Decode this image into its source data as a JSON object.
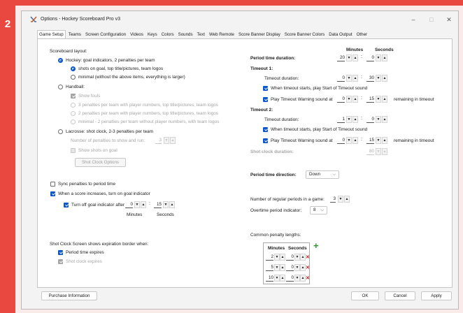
{
  "badge": "2",
  "window": {
    "title": "Options - Hockey Scoreboard Pro v3",
    "icon": "crossed-hockey-sticks-icon",
    "controls": {
      "minimize": "–",
      "maximize": "□",
      "close": "✕"
    }
  },
  "tabs": [
    "Game Setup",
    "Teams",
    "Screen Configuration",
    "Videos",
    "Keys",
    "Colors",
    "Sounds",
    "Text",
    "Web Remote",
    "Score Banner Display",
    "Score Banner Colors",
    "Data Output",
    "Other"
  ],
  "active_tab": "Game Setup",
  "left": {
    "layout_label": "Scoreboard layout:",
    "hockey": "Hockey: goal indicators, 2 penalties per team",
    "hockey_sub1": "shots on goal, top title/pictures, team logos",
    "hockey_sub2": "minimal (without the above items, everything is larger)",
    "handball": "Handball:",
    "show_fouls": "Show fouls",
    "hb_opt1": "3 penalties per team with player numbers, top title/pictures, team logos",
    "hb_opt2": "2 penalties per team with player numbers, top title/pictures, team logos",
    "hb_opt3": "minimal - 2 penalties per team without player numbers, with team logos",
    "lacrosse": "Lacrosse: shot clock, 2-3 penalties per team",
    "num_penalties_label": "Number of penalties to show and run:",
    "num_penalties_value": "3",
    "show_shots": "Show shots on goal",
    "shot_clock_options": "Shot Clock Options",
    "sync_penalties": "Sync penalties to period time",
    "score_increase": "When a score increases, turn on goal indicator",
    "turn_off_after": "Turn off goal indicator after",
    "turn_off_minutes": "0",
    "turn_off_seconds": "15",
    "minutes_label": "Minutes",
    "seconds_label": "Seconds",
    "shot_clock_border_label": "Shot Clock Screen shows expiration border when:",
    "period_time_expires": "Period time expires",
    "shot_clock_expires": "Shot clock expires",
    "purchase_info": "Purchase Information"
  },
  "right": {
    "minutes_header": "Minutes",
    "seconds_header": "Seconds",
    "period_time_duration": "Period time duration:",
    "period_minutes": "20",
    "period_seconds": "0",
    "timeout1": "Timeout 1:",
    "timeout_duration": "Timeout duration:",
    "t1_minutes": "0",
    "t1_seconds": "30",
    "t1_play_start": "When timeout starts, play Start of Timeout sound",
    "t1_play_warning": "Play Timeout Warning sound at",
    "t1_warn_minutes": "0",
    "t1_warn_seconds": "15",
    "remaining": "remaining in timeout",
    "timeout2": "Timeout 2:",
    "t2_minutes": "1",
    "t2_seconds": "0",
    "t2_play_start": "When timeout starts, play Start of Timeout sound",
    "t2_play_warning": "Play Timeout Warning sound at",
    "t2_warn_minutes": "0",
    "t2_warn_seconds": "15",
    "shot_clock_duration": "Shot clock duration:",
    "shot_clock_seconds": "80",
    "period_direction_label": "Period time direction:",
    "period_direction_value": "Down",
    "regular_periods_label": "Number of regular periods in a game:",
    "regular_periods_value": "3",
    "overtime_label": "Overtime period indicator:",
    "overtime_value": "8",
    "penalty_lengths_label": "Common penalty lengths:",
    "penalty_minutes_header": "Minutes",
    "penalty_seconds_header": "Seconds",
    "penalties": [
      {
        "minutes": "2",
        "seconds": "0"
      },
      {
        "minutes": "5",
        "seconds": "0"
      },
      {
        "minutes": "10",
        "seconds": "0"
      }
    ]
  },
  "footer": {
    "ok": "OK",
    "cancel": "Cancel",
    "apply": "Apply"
  },
  "colors": {
    "accent": "#0b57d0",
    "frame": "#e94840",
    "delete": "#d01818",
    "add": "#2d9a2d"
  }
}
